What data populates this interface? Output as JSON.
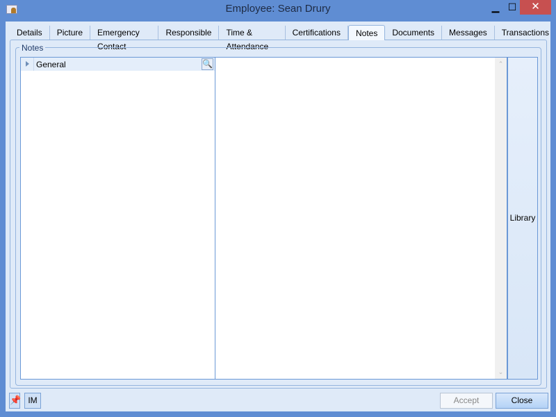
{
  "window": {
    "title": "Employee: Sean Drury",
    "minimize": "▁",
    "maximize": "☐",
    "close": "✕"
  },
  "tabs": [
    "Details",
    "Picture",
    "Emergency Contact",
    "Responsible",
    "Time & Attendance",
    "Certifications",
    "Notes",
    "Documents",
    "Messages",
    "Transactions"
  ],
  "active_tab": "Notes",
  "group_label": "Notes",
  "list": {
    "row_label": "General",
    "zoom_icon": "🔍"
  },
  "scroll": {
    "up": "⌃",
    "down": "⌄"
  },
  "library_label": "Library",
  "footer": {
    "pin_icon": "📌",
    "im_label": "IM",
    "accept_label": "Accept",
    "close_label": "Close"
  }
}
